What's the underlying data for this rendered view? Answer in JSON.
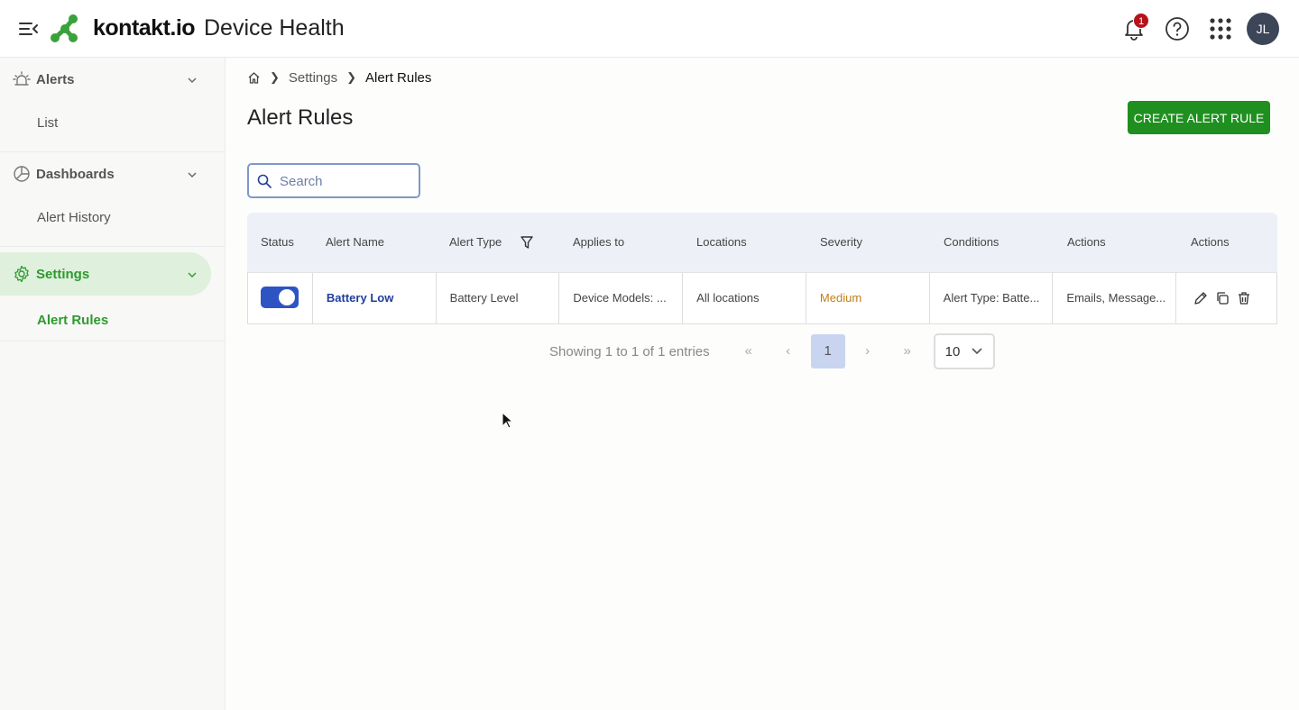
{
  "header": {
    "brand": "kontakt.io",
    "product": "Device Health",
    "notification_count": "1",
    "avatar_initials": "JL"
  },
  "sidebar": {
    "sections": [
      {
        "label": "Alerts",
        "icon": "alarm-icon",
        "items": [
          "List"
        ]
      },
      {
        "label": "Dashboards",
        "icon": "dashboard-icon",
        "items": [
          "Alert History"
        ]
      },
      {
        "label": "Settings",
        "icon": "gear-icon",
        "items": [
          "Alert Rules"
        ],
        "active": true
      }
    ]
  },
  "breadcrumb": {
    "home_icon": "home-icon",
    "items": [
      "Settings",
      "Alert Rules"
    ]
  },
  "page": {
    "title": "Alert Rules",
    "create_button": "CREATE ALERT RULE"
  },
  "search": {
    "placeholder": "Search",
    "value": ""
  },
  "table": {
    "columns": [
      "Status",
      "Alert Name",
      "Alert Type",
      "Applies to",
      "Locations",
      "Severity",
      "Conditions",
      "Actions",
      "Actions"
    ],
    "rows": [
      {
        "status_enabled": true,
        "alert_name": "Battery Low",
        "alert_type": "Battery Level",
        "applies_to": "Device Models: ...",
        "locations": "All locations",
        "severity": "Medium",
        "conditions": "Alert Type: Batte...",
        "actions": "Emails, Message..."
      }
    ]
  },
  "pagination": {
    "summary": "Showing 1 to 1 of 1 entries",
    "current_page": "1",
    "page_size": "10"
  },
  "colors": {
    "accent_green": "#1f8f1f",
    "sidebar_active_bg": "#dff0dc",
    "toggle_on": "#2e54c4",
    "severity_medium": "#c57d17",
    "badge_red": "#b5121b"
  }
}
